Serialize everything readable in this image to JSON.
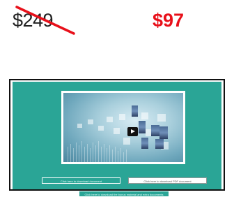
{
  "pricing": {
    "old_price": "$249",
    "new_price": "$97",
    "strike_color": "#e8101a",
    "new_price_color": "#e8101a"
  },
  "video": {
    "play_icon": "play-icon",
    "accent": "#2aa596"
  },
  "buttons": {
    "primary_download": "Click here to download document",
    "secondary_download": "Click here to download PDF document",
    "extra_download": "Click here to download the bonus material and extra documents"
  }
}
